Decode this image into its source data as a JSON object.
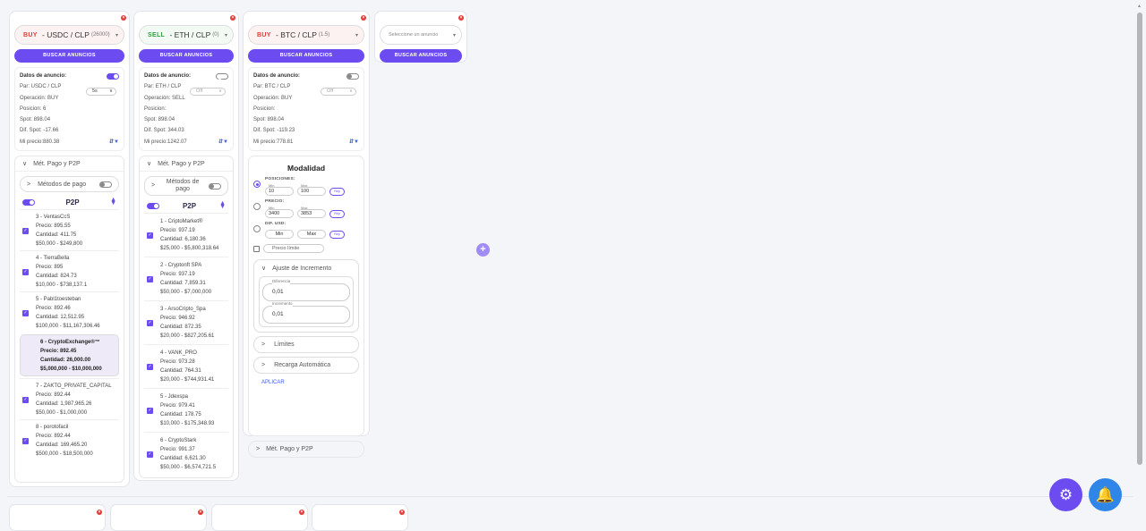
{
  "panels": [
    {
      "side": "BUY",
      "pair": "USDC / CLP",
      "amount": "(26000)",
      "search_btn": "BUSCAR ANUNCIOS",
      "info_title": "Datos de anuncio:",
      "info": {
        "par": "Par: USDC / CLP",
        "drop": "5s",
        "op": "Operación: BUY",
        "pos": "Posicion: 6",
        "spot": "Spot: 898.04",
        "dif": "Dif. Spot: -17.66",
        "mi": "Mi precio:880.38"
      },
      "acc_title": "Mét. Pago y P2P",
      "methods": "Métodos de pago",
      "p2p": "P2P",
      "items": [
        {
          "name": "3 - VentasCcS",
          "precio": "Precio: 895.55",
          "cantidad": "Cantidad: 411.75",
          "range": "$50,000 - $249,800"
        },
        {
          "name": "4 - TierraBella",
          "precio": "Precio: 895",
          "cantidad": "Cantidad: 824.73",
          "range": "$10,000 - $738,137.1"
        },
        {
          "name": "5 - Pabl1toesteban",
          "precio": "Precio: 892.46",
          "cantidad": "Cantidad: 12,512.95",
          "range": "$100,000 - $11,167,306.46"
        },
        {
          "name": "6 - CryptoExchange®™",
          "precio": "Precio: 892.45",
          "cantidad": "Cantidad: 26,000.00",
          "range": "$5,000,000 - $10,000,000",
          "highlight": true
        },
        {
          "name": "7 - ZAKTO_PRIVATE_CAPITAL",
          "precio": "Precio: 892.44",
          "cantidad": "Cantidad: 1,987,965.26",
          "range": "$50,000 - $1,000,000"
        },
        {
          "name": "8 - porotofacil",
          "precio": "Precio: 892.44",
          "cantidad": "Cantidad: 169,465.20",
          "range": "$500,000 - $18,500,000"
        }
      ]
    },
    {
      "side": "SELL",
      "pair": "ETH / CLP",
      "amount": "(0)",
      "search_btn": "BUSCAR ANUNCIOS",
      "info_title": "Datos de anuncio:",
      "info": {
        "par": "Par: ETH / CLP",
        "drop": "Off",
        "op": "Operación: SELL",
        "pos": "Posicion:",
        "spot": "Spot: 898.04",
        "dif": "Dif. Spot: 344.03",
        "mi": "Mi precio:1242.07"
      },
      "acc_title": "Mét. Pago y P2P",
      "methods": "Métodos de pago",
      "p2p": "P2P",
      "items": [
        {
          "name": "1 - CriptoMarket®",
          "precio": "Precio: 937.19",
          "cantidad": "Cantidad: 6,180.36",
          "range": "$25,000 - $5,800,318.64"
        },
        {
          "name": "2 - Cryptonft SPA",
          "precio": "Precio: 937.19",
          "cantidad": "Cantidad: 7,859.31",
          "range": "$50,000 - $7,000,000"
        },
        {
          "name": "3 - ArsoCripto_Spa",
          "precio": "Precio: 946.92",
          "cantidad": "Cantidad: 872.35",
          "range": "$20,000 - $827,205.61"
        },
        {
          "name": "4 - VANK_PRO",
          "precio": "Precio: 973.28",
          "cantidad": "Cantidad: 764.31",
          "range": "$20,000 - $744,931.41"
        },
        {
          "name": "5 - Jdexspa",
          "precio": "Precio: 979.41",
          "cantidad": "Cantidad: 178.75",
          "range": "$10,000 - $175,348.93"
        },
        {
          "name": "6 - CryptoStark",
          "precio": "Precio: 991.37",
          "cantidad": "Cantidad: 6,621.30",
          "range": "$50,000 - $6,574,721.5"
        }
      ]
    },
    {
      "side": "BUY",
      "pair": "BTC / CLP",
      "amount": "(1.5)",
      "search_btn": "BUSCAR ANUNCIOS",
      "info_title": "Datos de anuncio:",
      "info": {
        "par": "Par: BTC / CLP",
        "drop": "Off",
        "op": "Operación: BUY",
        "pos": "Posicion:",
        "spot": "Spot: 898.04",
        "dif": "Dif. Spot: -119.23",
        "mi": "Mi precio:778.81"
      },
      "modalidad": {
        "title": "Modalidad",
        "posiciones": "POSICIONES:",
        "pos_min": "10",
        "pos_max": "100",
        "precio": "PRECIO:",
        "precio_min": "3400",
        "precio_max": "3853",
        "dif": "DIF. USD:",
        "dif_min": "Min",
        "dif_max": "Max",
        "min_label": "Min",
        "max_label": "Max",
        "rep": "Rep",
        "precio_limite": "Precio límite",
        "ajuste": "Ajuste de Incremento",
        "diferencia_label": "Diferencia",
        "diferencia": "0,01",
        "incremento_label": "Incremento",
        "incremento": "0,01",
        "limites": "Límites",
        "recarga": "Recarga Automática",
        "aplicar": "APLICAR",
        "acc_title": "Mét. Pago y P2P"
      }
    },
    {
      "select_placeholder": "Seleccione un anuncio",
      "search_btn": "BUSCAR ANUNCIOS"
    }
  ],
  "add_button": "+",
  "colors": {
    "accent": "#6c4cf1",
    "buy": "#e53935",
    "sell": "#2e9e3f",
    "bell": "#2f86e8"
  }
}
